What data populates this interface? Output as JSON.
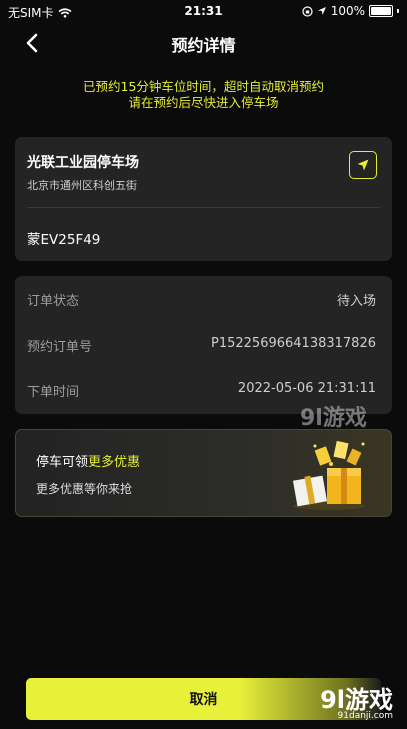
{
  "status_bar": {
    "carrier": "无SIM卡",
    "time": "21:31",
    "battery": "100%"
  },
  "header": {
    "title": "预约详情"
  },
  "notice": {
    "line1": "已预约15分钟车位时间，超时自动取消预约",
    "line2": "请在预约后尽快进入停车场"
  },
  "parking": {
    "name": "光联工业园停车场",
    "address": "北京市通州区科创五街",
    "plate": "蒙EV25F49"
  },
  "order": {
    "rows": [
      {
        "label": "订单状态",
        "value": "待入场"
      },
      {
        "label": "预约订单号",
        "value": "P1522569664138317826"
      },
      {
        "label": "下单时间",
        "value": "2022-05-06 21:31:11"
      }
    ]
  },
  "promo": {
    "line1_prefix": "停车可领",
    "line1_highlight": "更多优惠",
    "line2": "更多优惠等你来抢"
  },
  "footer": {
    "cancel_label": "取消"
  },
  "watermark": {
    "brand": "9l游戏",
    "domain": "91danji.com"
  },
  "colors": {
    "accent": "#e6ee34",
    "background": "#0b0b0b",
    "card": "#242424"
  }
}
